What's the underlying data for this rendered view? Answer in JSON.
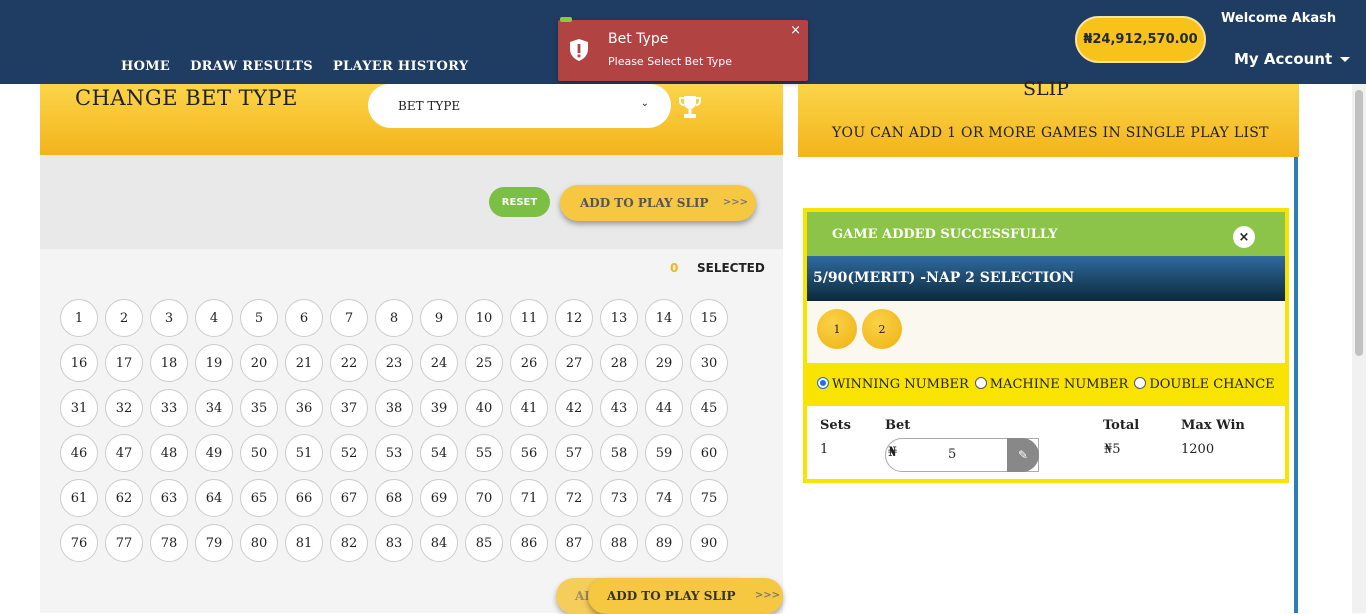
{
  "nav": {
    "home": "HOME",
    "draw_results": "DRAW RESULTS",
    "player_history": "PLAYER HISTORY"
  },
  "account": {
    "balance": "₦24,912,570.00",
    "welcome": "Welcome Akash",
    "menu_label": "My Account"
  },
  "toast": {
    "title": "Bet Type",
    "message": "Please Select Bet Type",
    "close": "×"
  },
  "bet_type": {
    "heading": "CHANGE BET TYPE",
    "select_value": "BET TYPE"
  },
  "actions": {
    "reset": "RESET",
    "add_to_slip": "ADD TO PLAY SLIP",
    "arrows": ">>>"
  },
  "selection": {
    "count": "0",
    "label": "SELECTED"
  },
  "numbers": [
    "1",
    "2",
    "3",
    "4",
    "5",
    "6",
    "7",
    "8",
    "9",
    "10",
    "11",
    "12",
    "13",
    "14",
    "15",
    "16",
    "17",
    "18",
    "19",
    "20",
    "21",
    "22",
    "23",
    "24",
    "25",
    "26",
    "27",
    "28",
    "29",
    "30",
    "31",
    "32",
    "33",
    "34",
    "35",
    "36",
    "37",
    "38",
    "39",
    "40",
    "41",
    "42",
    "43",
    "44",
    "45",
    "46",
    "47",
    "48",
    "49",
    "50",
    "51",
    "52",
    "53",
    "54",
    "55",
    "56",
    "57",
    "58",
    "59",
    "60",
    "61",
    "62",
    "63",
    "64",
    "65",
    "66",
    "67",
    "68",
    "69",
    "70",
    "71",
    "72",
    "73",
    "74",
    "75",
    "76",
    "77",
    "78",
    "79",
    "80",
    "81",
    "82",
    "83",
    "84",
    "85",
    "86",
    "87",
    "88",
    "89",
    "90"
  ],
  "slip": {
    "title": "SLIP",
    "subtitle": "YOU CAN ADD 1 OR MORE GAMES IN SINGLE PLAY LIST",
    "card_title": "GAME ADDED SUCCESSFULLY",
    "close": "×",
    "game": "5/90(MERIT) -NAP 2 SELECTION",
    "balls": [
      "1",
      "2"
    ],
    "options": [
      "WINNING NUMBER",
      "MACHINE NUMBER",
      "DOUBLE CHANCE"
    ],
    "table": {
      "headers": {
        "sets": "Sets",
        "bet": "Bet",
        "total": "Total",
        "max_win": "Max Win"
      },
      "sets": "1",
      "currency": "₦",
      "bet_value": "5",
      "total": "₦5",
      "max_win": "1200"
    }
  },
  "colors": {
    "header": "#1f3d63",
    "accent_yellow": "#f3b41c",
    "success_green": "#8cc449",
    "error_red": "#b14343"
  }
}
